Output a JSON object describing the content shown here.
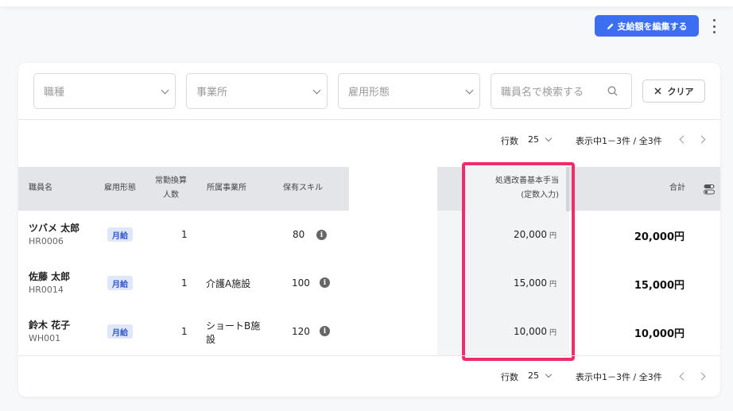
{
  "toolbar": {
    "edit_button_label": "支給額を編集する"
  },
  "filters": {
    "job_type_placeholder": "職種",
    "office_placeholder": "事業所",
    "employment_type_placeholder": "雇用形態",
    "search_placeholder": "職員名で検索する",
    "clear_label": "クリア"
  },
  "pager": {
    "rows_label": "行数",
    "rows_value": "25",
    "range_text": "表示中1－3件 / 全3件"
  },
  "table": {
    "headers": {
      "name": "職員名",
      "employment_type": "雇用形態",
      "fte_line1": "常勤換算",
      "fte_line2": "人数",
      "office": "所属事業所",
      "skills": "保有スキル",
      "allowance_line1": "処遇改善基本手当",
      "allowance_line2": "(定数入力)",
      "total": "合計"
    },
    "rows": [
      {
        "name": "ツバメ 太郎",
        "code": "HR0006",
        "employment_type": "月給",
        "fte": "1",
        "office_line1": "",
        "office_line2": "",
        "skills": "80",
        "allowance": "20,000",
        "allowance_unit": "円",
        "total": "20,000円"
      },
      {
        "name": "佐藤 太郎",
        "code": "HR0014",
        "employment_type": "月給",
        "fte": "1",
        "office_line1": "介護A施設",
        "office_line2": "",
        "skills": "100",
        "allowance": "15,000",
        "allowance_unit": "円",
        "total": "15,000円"
      },
      {
        "name": "鈴木 花子",
        "code": "WH001",
        "employment_type": "月給",
        "fte": "1",
        "office_line1": "ショートB施",
        "office_line2": "設",
        "skills": "120",
        "allowance": "10,000",
        "allowance_unit": "円",
        "total": "10,000円"
      }
    ]
  },
  "colors": {
    "primary": "#3b6ef0",
    "highlight": "#ef2d6b",
    "badge_bg": "#dfe7fb",
    "header_bg": "#e3e5e9"
  },
  "icons": [
    "pencil-icon",
    "kebab-menu-icon",
    "chevron-down-icon",
    "search-icon",
    "close-icon",
    "chevron-left-icon",
    "chevron-right-icon",
    "info-icon",
    "column-settings-icon"
  ]
}
